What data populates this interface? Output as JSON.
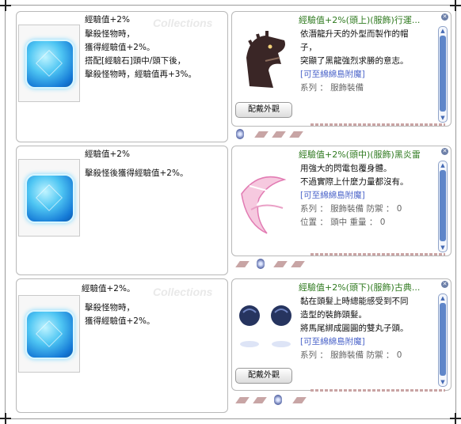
{
  "watermark": "Collections",
  "close_glyph": "✕",
  "button_label": "配戴外觀",
  "rows": [
    {
      "left_title": "經驗值+2%",
      "left_desc": "擊殺怪物時，\n獲得經驗值+2%。\n搭配[經驗石]頭中/頭下後，\n擊殺怪物時，經驗值再+3%。",
      "right_title": "經驗值+2%(頭上)(服飾)行運...",
      "right_lines": [
        "依潛龍升天的外型而製作的帽",
        "子，",
        "突顯了黑龍強烈求勝的意志。"
      ],
      "right_link": "[可至綿綿島附魔]",
      "attr_lines": [
        "系列 ： 服飾裝備"
      ]
    },
    {
      "left_title": "經驗值+2%",
      "left_desc": "擊殺怪後獲得經驗值+2%。",
      "right_title": "經驗值+2%(頭中)(服飾)黑炎雷",
      "right_lines": [
        "用強大的閃電包覆身體。",
        "不過實際上什麼力量都沒有。"
      ],
      "right_link": "[可至綿綿島附魔]",
      "attr_lines": [
        "系列 ： 服飾裝備  防禦 ： 0",
        "位置 ： 頭中  重量 ： 0"
      ]
    },
    {
      "left_title": "經驗值+2%。",
      "left_desc": "擊殺怪物時，\n獲得經驗值+2%。",
      "right_title": "經驗值+2%(頭下)(服飾)古典...",
      "right_lines": [
        "黏在頭髮上時總能感受到不同",
        "造型的裝飾頭髮。",
        "將馬尾綁成圓圓的雙丸子頭。"
      ],
      "right_link": "[可至綿綿島附魔]",
      "attr_lines": [
        "系列 ： 服飾裝備  防禦 ： 0"
      ]
    }
  ],
  "icons": {
    "left_item": "blue-gem-icon",
    "right_items": [
      "black-dragon-hat-icon",
      "black-flame-lightning-icon",
      "twin-bun-hair-icon"
    ],
    "slot": "slot-diamond-icon",
    "card": "card-slot-icon"
  },
  "colors": {
    "title_green": "#2f7a1f",
    "link_blue": "#4a63c9",
    "scroll_blue": "#5f86c9"
  }
}
